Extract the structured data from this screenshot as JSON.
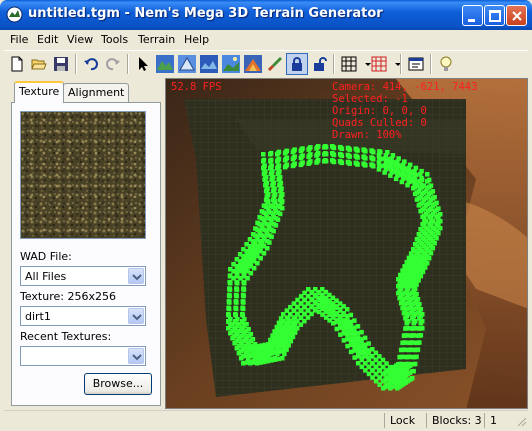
{
  "window": {
    "title": "untitled.tgm - Nem's Mega 3D Terrain Generator",
    "icon": "app-icon"
  },
  "menu": [
    {
      "label": "File"
    },
    {
      "label": "Edit"
    },
    {
      "label": "View"
    },
    {
      "label": "Tools"
    },
    {
      "label": "Terrain"
    },
    {
      "label": "Help"
    }
  ],
  "toolbar": {
    "buttons": [
      "new-file-icon",
      "open-folder-icon",
      "save-icon",
      "undo-icon",
      "redo-icon",
      "select-arrow-icon",
      "terrain-tool-1-icon",
      "terrain-tool-2-icon",
      "terrain-tool-3-icon",
      "terrain-tool-4-icon",
      "terrain-tool-5-icon",
      "brush-icon",
      "lock-icon",
      "unlock-icon",
      "grid-icon",
      "red-grid-icon",
      "properties-icon",
      "light-bulb-icon"
    ]
  },
  "left_panel": {
    "tabs": [
      {
        "label": "Texture",
        "active": true
      },
      {
        "label": "Alignment",
        "active": false
      }
    ],
    "wad_label": "WAD File:",
    "wad_value": "All Files",
    "texture_label": "Texture: 256x256",
    "texture_value": "dirt1",
    "recent_label": "Recent Textures:",
    "recent_value": "",
    "browse_label": "Browse..."
  },
  "viewport": {
    "fps": "52.8 FPS",
    "camera": "Camera: 414, -621, 7443",
    "selected": "Selected: -1",
    "origin": "Origin: 0, 0, 0",
    "quads_culled": "Quads Culled: 0",
    "drawn": "Drawn: 100%",
    "hud_color": "#ff2020",
    "marker_color": "#33ff33"
  },
  "status": {
    "lock": "Lock",
    "blocks": "Blocks: 3",
    "count": "1"
  }
}
